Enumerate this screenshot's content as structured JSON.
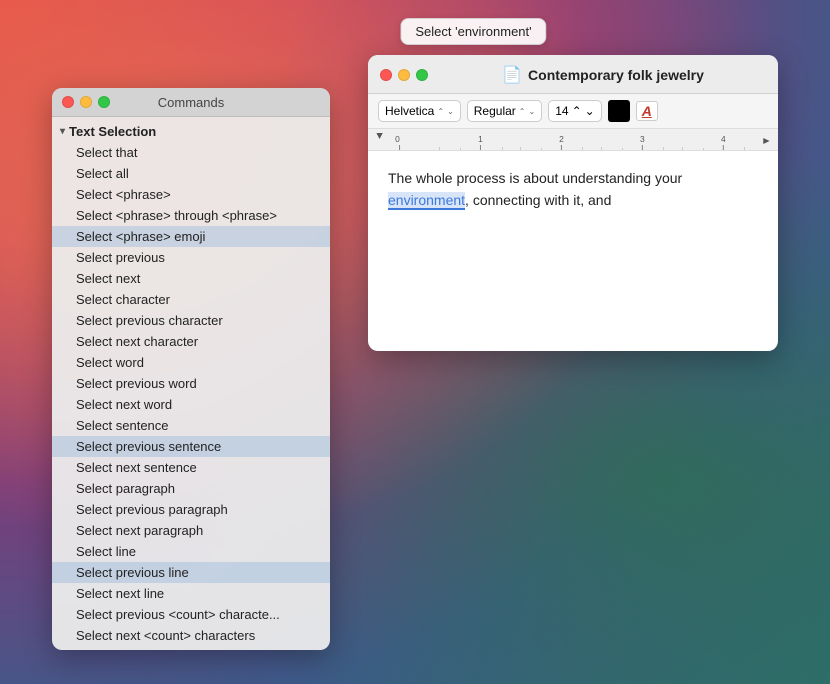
{
  "tooltip": {
    "label": "Select 'environment'"
  },
  "commands_panel": {
    "title": "Commands",
    "traffic_lights": {
      "close": "close",
      "minimize": "minimize",
      "maximize": "maximize"
    },
    "section": {
      "label": "Text Selection",
      "items": [
        {
          "label": "Select that",
          "highlighted": false
        },
        {
          "label": "Select all",
          "highlighted": false
        },
        {
          "label": "Select <phrase>",
          "highlighted": false
        },
        {
          "label": "Select <phrase> through <phrase>",
          "highlighted": false
        },
        {
          "label": "Select <phrase> emoji",
          "highlighted": true
        },
        {
          "label": "Select previous",
          "highlighted": false
        },
        {
          "label": "Select next",
          "highlighted": false
        },
        {
          "label": "Select character",
          "highlighted": false
        },
        {
          "label": "Select previous character",
          "highlighted": false
        },
        {
          "label": "Select next character",
          "highlighted": false
        },
        {
          "label": "Select word",
          "highlighted": false
        },
        {
          "label": "Select previous word",
          "highlighted": false
        },
        {
          "label": "Select next word",
          "highlighted": false
        },
        {
          "label": "Select sentence",
          "highlighted": false
        },
        {
          "label": "Select previous sentence",
          "highlighted": true
        },
        {
          "label": "Select next sentence",
          "highlighted": false
        },
        {
          "label": "Select paragraph",
          "highlighted": false
        },
        {
          "label": "Select previous paragraph",
          "highlighted": false
        },
        {
          "label": "Select next paragraph",
          "highlighted": false
        },
        {
          "label": "Select line",
          "highlighted": false
        },
        {
          "label": "Select previous line",
          "highlighted": true
        },
        {
          "label": "Select next line",
          "highlighted": false
        },
        {
          "label": "Select previous <count> characte...",
          "highlighted": false
        },
        {
          "label": "Select next <count> characters",
          "highlighted": false
        }
      ]
    }
  },
  "editor_panel": {
    "title": "Contemporary folk jewelry",
    "doc_icon": "📄",
    "toolbar": {
      "font": "Helvetica",
      "style": "Regular",
      "size": "14"
    },
    "content": {
      "before": "The whole process is about understanding your ",
      "highlighted": "environment",
      "after": ", connecting with it, and"
    }
  },
  "ruler": {
    "marks": [
      "0",
      "1",
      "2",
      "3",
      "4"
    ]
  }
}
